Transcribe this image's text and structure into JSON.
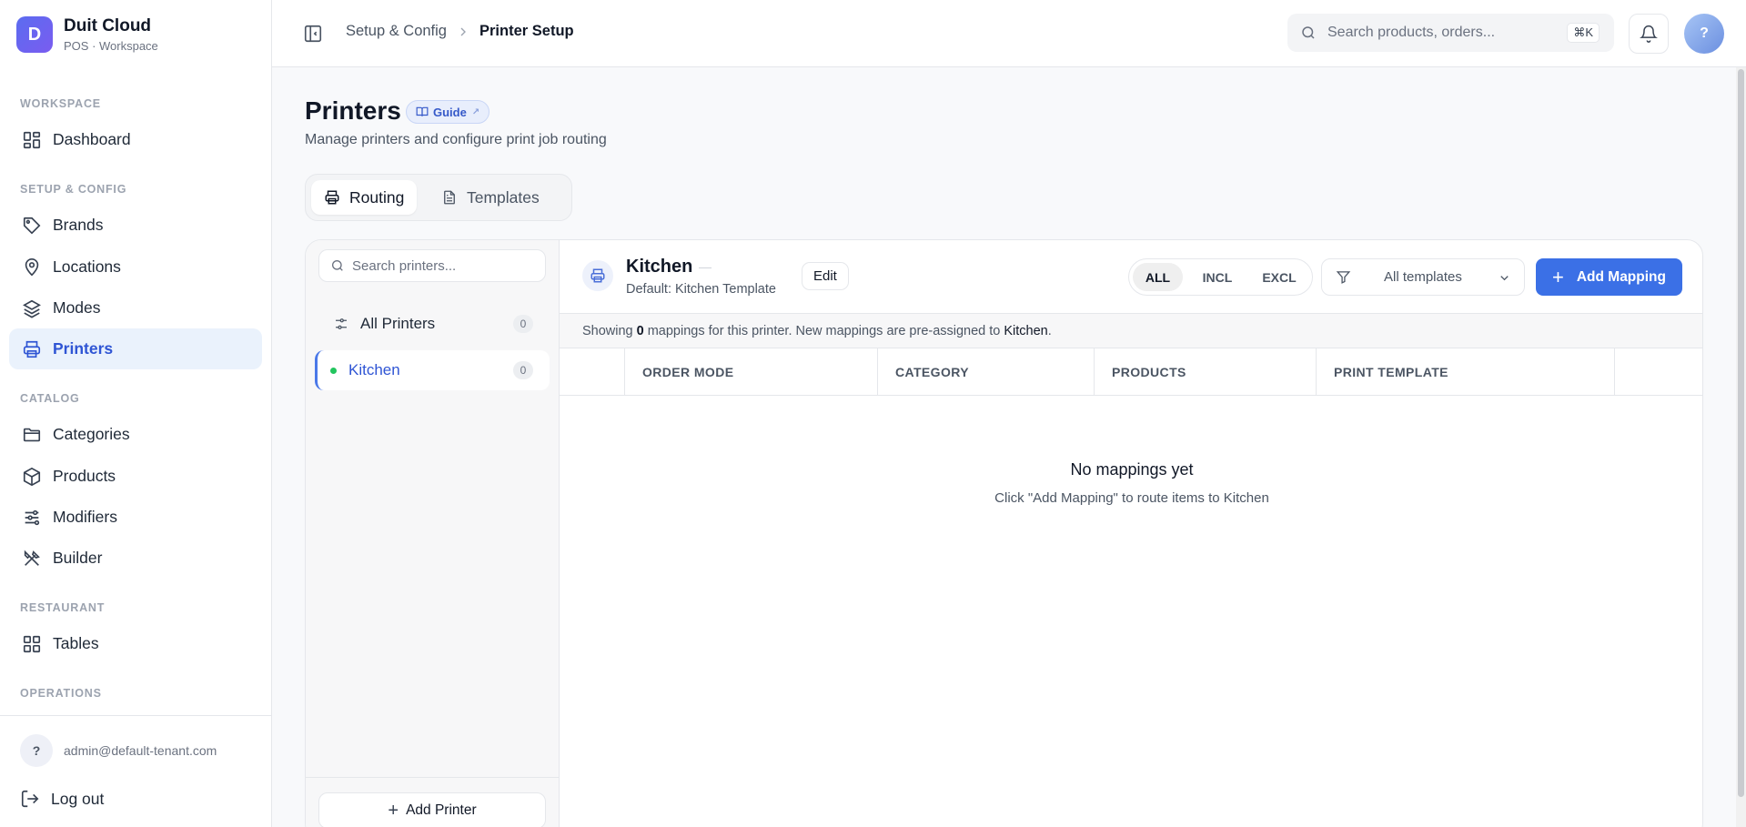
{
  "brand": {
    "initial": "D",
    "name": "Duit Cloud",
    "sub": "POS · Workspace"
  },
  "sidebar": {
    "sections": [
      "WORKSPACE",
      "SETUP & CONFIG",
      "CATALOG",
      "RESTAURANT",
      "OPERATIONS"
    ],
    "items": [
      {
        "label": "Dashboard",
        "icon": "dashboard-icon"
      },
      {
        "label": "Brands",
        "icon": "tag-icon"
      },
      {
        "label": "Locations",
        "icon": "map-pin-icon"
      },
      {
        "label": "Modes",
        "icon": "layers-icon"
      },
      {
        "label": "Printers",
        "icon": "printer-icon",
        "active": true
      },
      {
        "label": "Categories",
        "icon": "folder-icon"
      },
      {
        "label": "Products",
        "icon": "box-icon"
      },
      {
        "label": "Modifiers",
        "icon": "sliders-icon"
      },
      {
        "label": "Builder",
        "icon": "utensils-icon"
      },
      {
        "label": "Tables",
        "icon": "grid-icon"
      }
    ],
    "user": {
      "initial": "?",
      "email": "admin@default-tenant.com"
    },
    "logout": "Log out"
  },
  "topbar": {
    "breadcrumb": [
      "Setup & Config",
      "Printer Setup"
    ],
    "search_placeholder": "Search products, orders...",
    "search_shortcut": "⌘K",
    "avatar_initial": "?"
  },
  "page": {
    "title": "Printers",
    "guide_label": "Guide",
    "subtitle": "Manage printers and configure print job routing",
    "tabs": [
      "Routing",
      "Templates"
    ]
  },
  "printers": {
    "search_placeholder": "Search printers...",
    "all": {
      "label": "All Printers",
      "count": "0"
    },
    "list": [
      {
        "name": "Kitchen",
        "count": "0",
        "status_color": "#22c55e"
      }
    ],
    "add_label": "Add Printer"
  },
  "detail": {
    "name": "Kitchen",
    "default_template": "Default: Kitchen Template",
    "edit_label": "Edit",
    "segments": [
      "ALL",
      "INCL",
      "EXCL"
    ],
    "template_filter": "All templates",
    "add_mapping_label": "Add Mapping",
    "showing": {
      "prefix": "Showing",
      "count": "0",
      "middle": "mappings for this printer. New mappings are pre-assigned to",
      "printer": "Kitchen",
      "suffix": "."
    },
    "columns": [
      "ORDER MODE",
      "CATEGORY",
      "PRODUCTS",
      "PRINT TEMPLATE"
    ],
    "empty_title": "No mappings yet",
    "empty_sub": "Click \"Add Mapping\" to route items to Kitchen"
  },
  "colors": {
    "accent": "#3b70e6",
    "active_bg": "#eaf2fc",
    "active_text": "#2f55d4",
    "status_online": "#22c55e"
  }
}
